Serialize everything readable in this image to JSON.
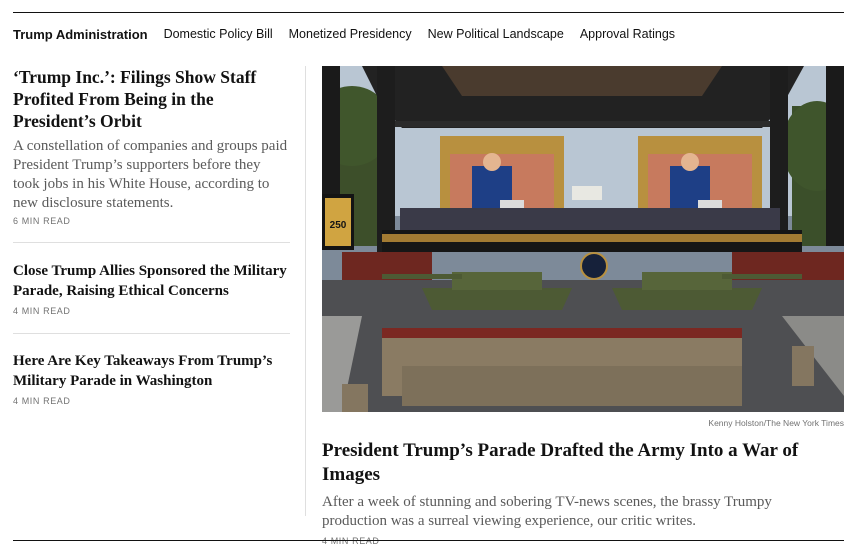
{
  "nav": {
    "section_title": "Trump Administration",
    "links": [
      "Domestic Policy Bill",
      "Monetized Presidency",
      "New Political Landscape",
      "Approval Ratings"
    ]
  },
  "stories": [
    {
      "headline": "‘Trump Inc.’: Filings Show Staff Profited From Being in the President’s Orbit",
      "summary": "A constellation of companies and groups paid President Trump’s supporters before they took jobs in his White House, according to new disclosure statements.",
      "read_time": "6 MIN READ"
    },
    {
      "headline": "Close Trump Allies Sponsored the Military Parade, Raising Ethical Concerns",
      "read_time": "4 MIN READ"
    },
    {
      "headline": "Here Are Key Takeaways From Trump’s Military Parade in Washington",
      "read_time": "4 MIN READ"
    }
  ],
  "lead": {
    "image_alt": "Soldiers marching past tanks in front of a stage with large screens showing President Trump",
    "stage_sign": "250",
    "credit": "Kenny Holston/The New York Times",
    "headline": "President Trump’s Parade Drafted the Army Into a War of Images",
    "summary": "After a week of stunning and sobering TV-news scenes, the brassy Trumpy production was a surreal viewing experience, our critic writes.",
    "read_time": "4 MIN READ"
  },
  "colors": {
    "text": "#121212",
    "summary": "#5a5a5a",
    "meta": "#727272",
    "rule": "#dfdfdf"
  }
}
